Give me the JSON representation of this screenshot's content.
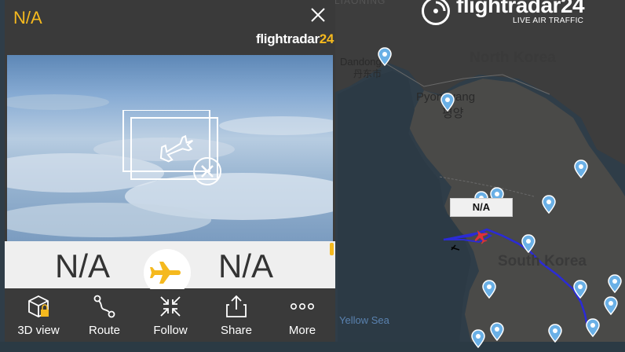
{
  "map": {
    "countries": {
      "north_korea": "North Korea",
      "south_korea": "South Korea"
    },
    "cities": {
      "dandong": "Dandong",
      "dandong_local": "丹东市",
      "pyongyang": "Pyongyang",
      "pyongyang_local": "평양"
    },
    "sea": "Yellow Sea",
    "top_fragment": "LIAONING",
    "selected_flight_tag": "N/A"
  },
  "brand": {
    "name_part1": "flightradar",
    "name_part2": "24",
    "subtitle": "LIVE AIR TRAFFIC"
  },
  "panel": {
    "title": "N/A",
    "logo_part1": "flightradar",
    "logo_part2": "24",
    "origin_code": "N/A",
    "destination_code": "N/A",
    "tools": [
      {
        "label": "3D view",
        "icon": "3d-cube-lock-icon"
      },
      {
        "label": "Route",
        "icon": "route-icon"
      },
      {
        "label": "Follow",
        "icon": "follow-arrows-icon"
      },
      {
        "label": "Share",
        "icon": "share-icon"
      },
      {
        "label": "More",
        "icon": "more-dots-icon"
      }
    ]
  },
  "colors": {
    "accent": "#f5b91e",
    "panel_bg": "#3a3a3a",
    "track": "#2b2bd6",
    "selected_plane": "#e0303a",
    "pin": "#6ab0e6"
  }
}
